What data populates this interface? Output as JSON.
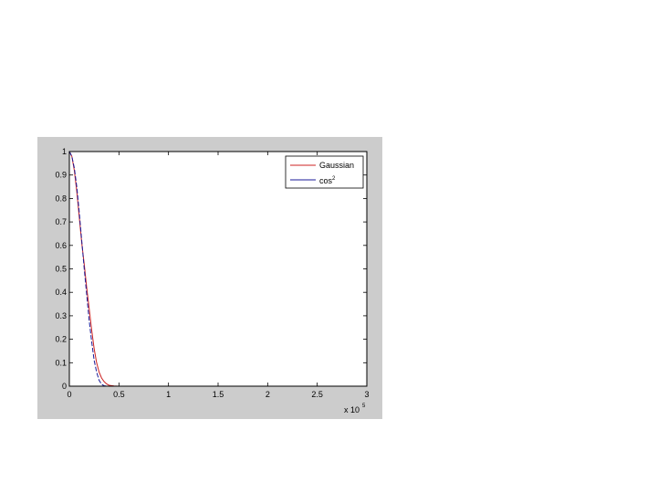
{
  "chart_data": {
    "type": "line",
    "title": "",
    "xlabel": "",
    "ylabel": "",
    "x_multiplier": "x 10",
    "x_multiplier_exp": "5",
    "xlim": [
      0,
      3
    ],
    "ylim": [
      0,
      1
    ],
    "x_ticks": [
      0,
      0.5,
      1,
      1.5,
      2,
      2.5,
      3
    ],
    "x_tick_labels": [
      "0",
      "0.5",
      "1",
      "1.5",
      "2",
      "2.5",
      "3"
    ],
    "y_ticks": [
      0,
      0.1,
      0.2,
      0.3,
      0.4,
      0.5,
      0.6,
      0.7,
      0.8,
      0.9,
      1
    ],
    "y_tick_labels": [
      "0",
      "0.1",
      "0.2",
      "0.3",
      "0.4",
      "0.5",
      "0.6",
      "0.7",
      "0.8",
      "0.9",
      "1"
    ],
    "legend_position": "top-right",
    "grid": false,
    "series": [
      {
        "name": "Gaussian",
        "color": "#cc2222",
        "x": [
          0,
          0.025,
          0.05,
          0.075,
          0.1,
          0.125,
          0.15,
          0.175,
          0.2,
          0.225,
          0.25,
          0.275,
          0.3,
          0.325,
          0.35,
          0.375,
          0.4,
          0.45,
          0.5,
          1,
          1.5,
          2,
          2.5,
          3
        ],
        "y": [
          1,
          0.98,
          0.92,
          0.83,
          0.72,
          0.61,
          0.52,
          0.42,
          0.33,
          0.24,
          0.16,
          0.1,
          0.06,
          0.035,
          0.02,
          0.01,
          0.004,
          0.001,
          0,
          0,
          0,
          0,
          0,
          0
        ]
      },
      {
        "name": "cos",
        "name_sup": "2",
        "color": "#1a1a99",
        "x": [
          0,
          0.025,
          0.05,
          0.075,
          0.1,
          0.125,
          0.15,
          0.175,
          0.2,
          0.225,
          0.25,
          0.275,
          0.3,
          0.325,
          0.35,
          0.375,
          0.4,
          0.45,
          0.5,
          1,
          1.5,
          2,
          2.5,
          3
        ],
        "y": [
          1,
          0.98,
          0.93,
          0.85,
          0.74,
          0.62,
          0.5,
          0.39,
          0.28,
          0.19,
          0.11,
          0.06,
          0.025,
          0.008,
          0.002,
          0,
          0,
          0,
          0,
          0,
          0,
          0,
          0,
          0
        ]
      }
    ]
  }
}
